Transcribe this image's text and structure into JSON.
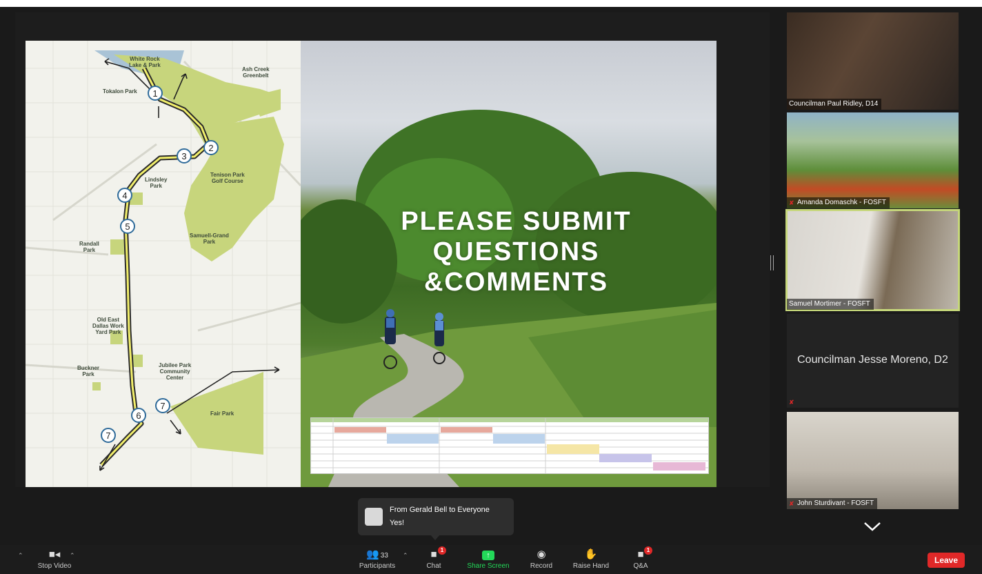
{
  "slide": {
    "title_lines": [
      "PLEASE SUBMIT",
      "QUESTIONS",
      "&COMMENTS"
    ],
    "map_labels": {
      "white_rock": "White Rock\nLake & Park",
      "ash_creek": "Ash Creek\nGreenbelt",
      "tokalon": "Tokalon Park",
      "tenison": "Tenison Park\nGolf Course",
      "lindsley": "Lindsley\nPark",
      "samuell": "Samuell-Grand\nPark",
      "randall": "Randall\nPark",
      "old_east": "Old East\nDallas Work\nYard Park",
      "buckner": "Buckner\nPark",
      "jubilee": "Jubilee Park\nCommunity\nCenter",
      "fair_park": "Fair Park"
    },
    "route_markers": [
      "1",
      "2",
      "3",
      "4",
      "5",
      "6",
      "7",
      "7"
    ]
  },
  "participants": [
    {
      "name": "Councilman Paul Ridley, D14",
      "muted": false,
      "video": true
    },
    {
      "name": "Amanda Domaschk - FOSFT",
      "muted": true,
      "video": true
    },
    {
      "name": "Samuel Mortimer - FOSFT",
      "muted": false,
      "video": true,
      "active_speaker": true
    },
    {
      "name": "Councilman Jesse Moreno, D2",
      "muted": true,
      "video": false
    },
    {
      "name": "John Sturdivant - FOSFT",
      "muted": true,
      "video": true
    }
  ],
  "chat_toast": {
    "from": "From Gerald Bell to Everyone",
    "message": "Yes!"
  },
  "toolbar": {
    "stop_video": "Stop Video",
    "participants": "Participants",
    "participants_count": "33",
    "chat": "Chat",
    "chat_badge": "1",
    "share_screen": "Share Screen",
    "record": "Record",
    "raise_hand": "Raise Hand",
    "qa": "Q&A",
    "qa_badge": "1",
    "leave": "Leave"
  },
  "colors": {
    "leave": "#e02828",
    "share_screen": "#23d959",
    "active_speaker_border": "#c6d77b",
    "trail": "#f2ef6b"
  }
}
